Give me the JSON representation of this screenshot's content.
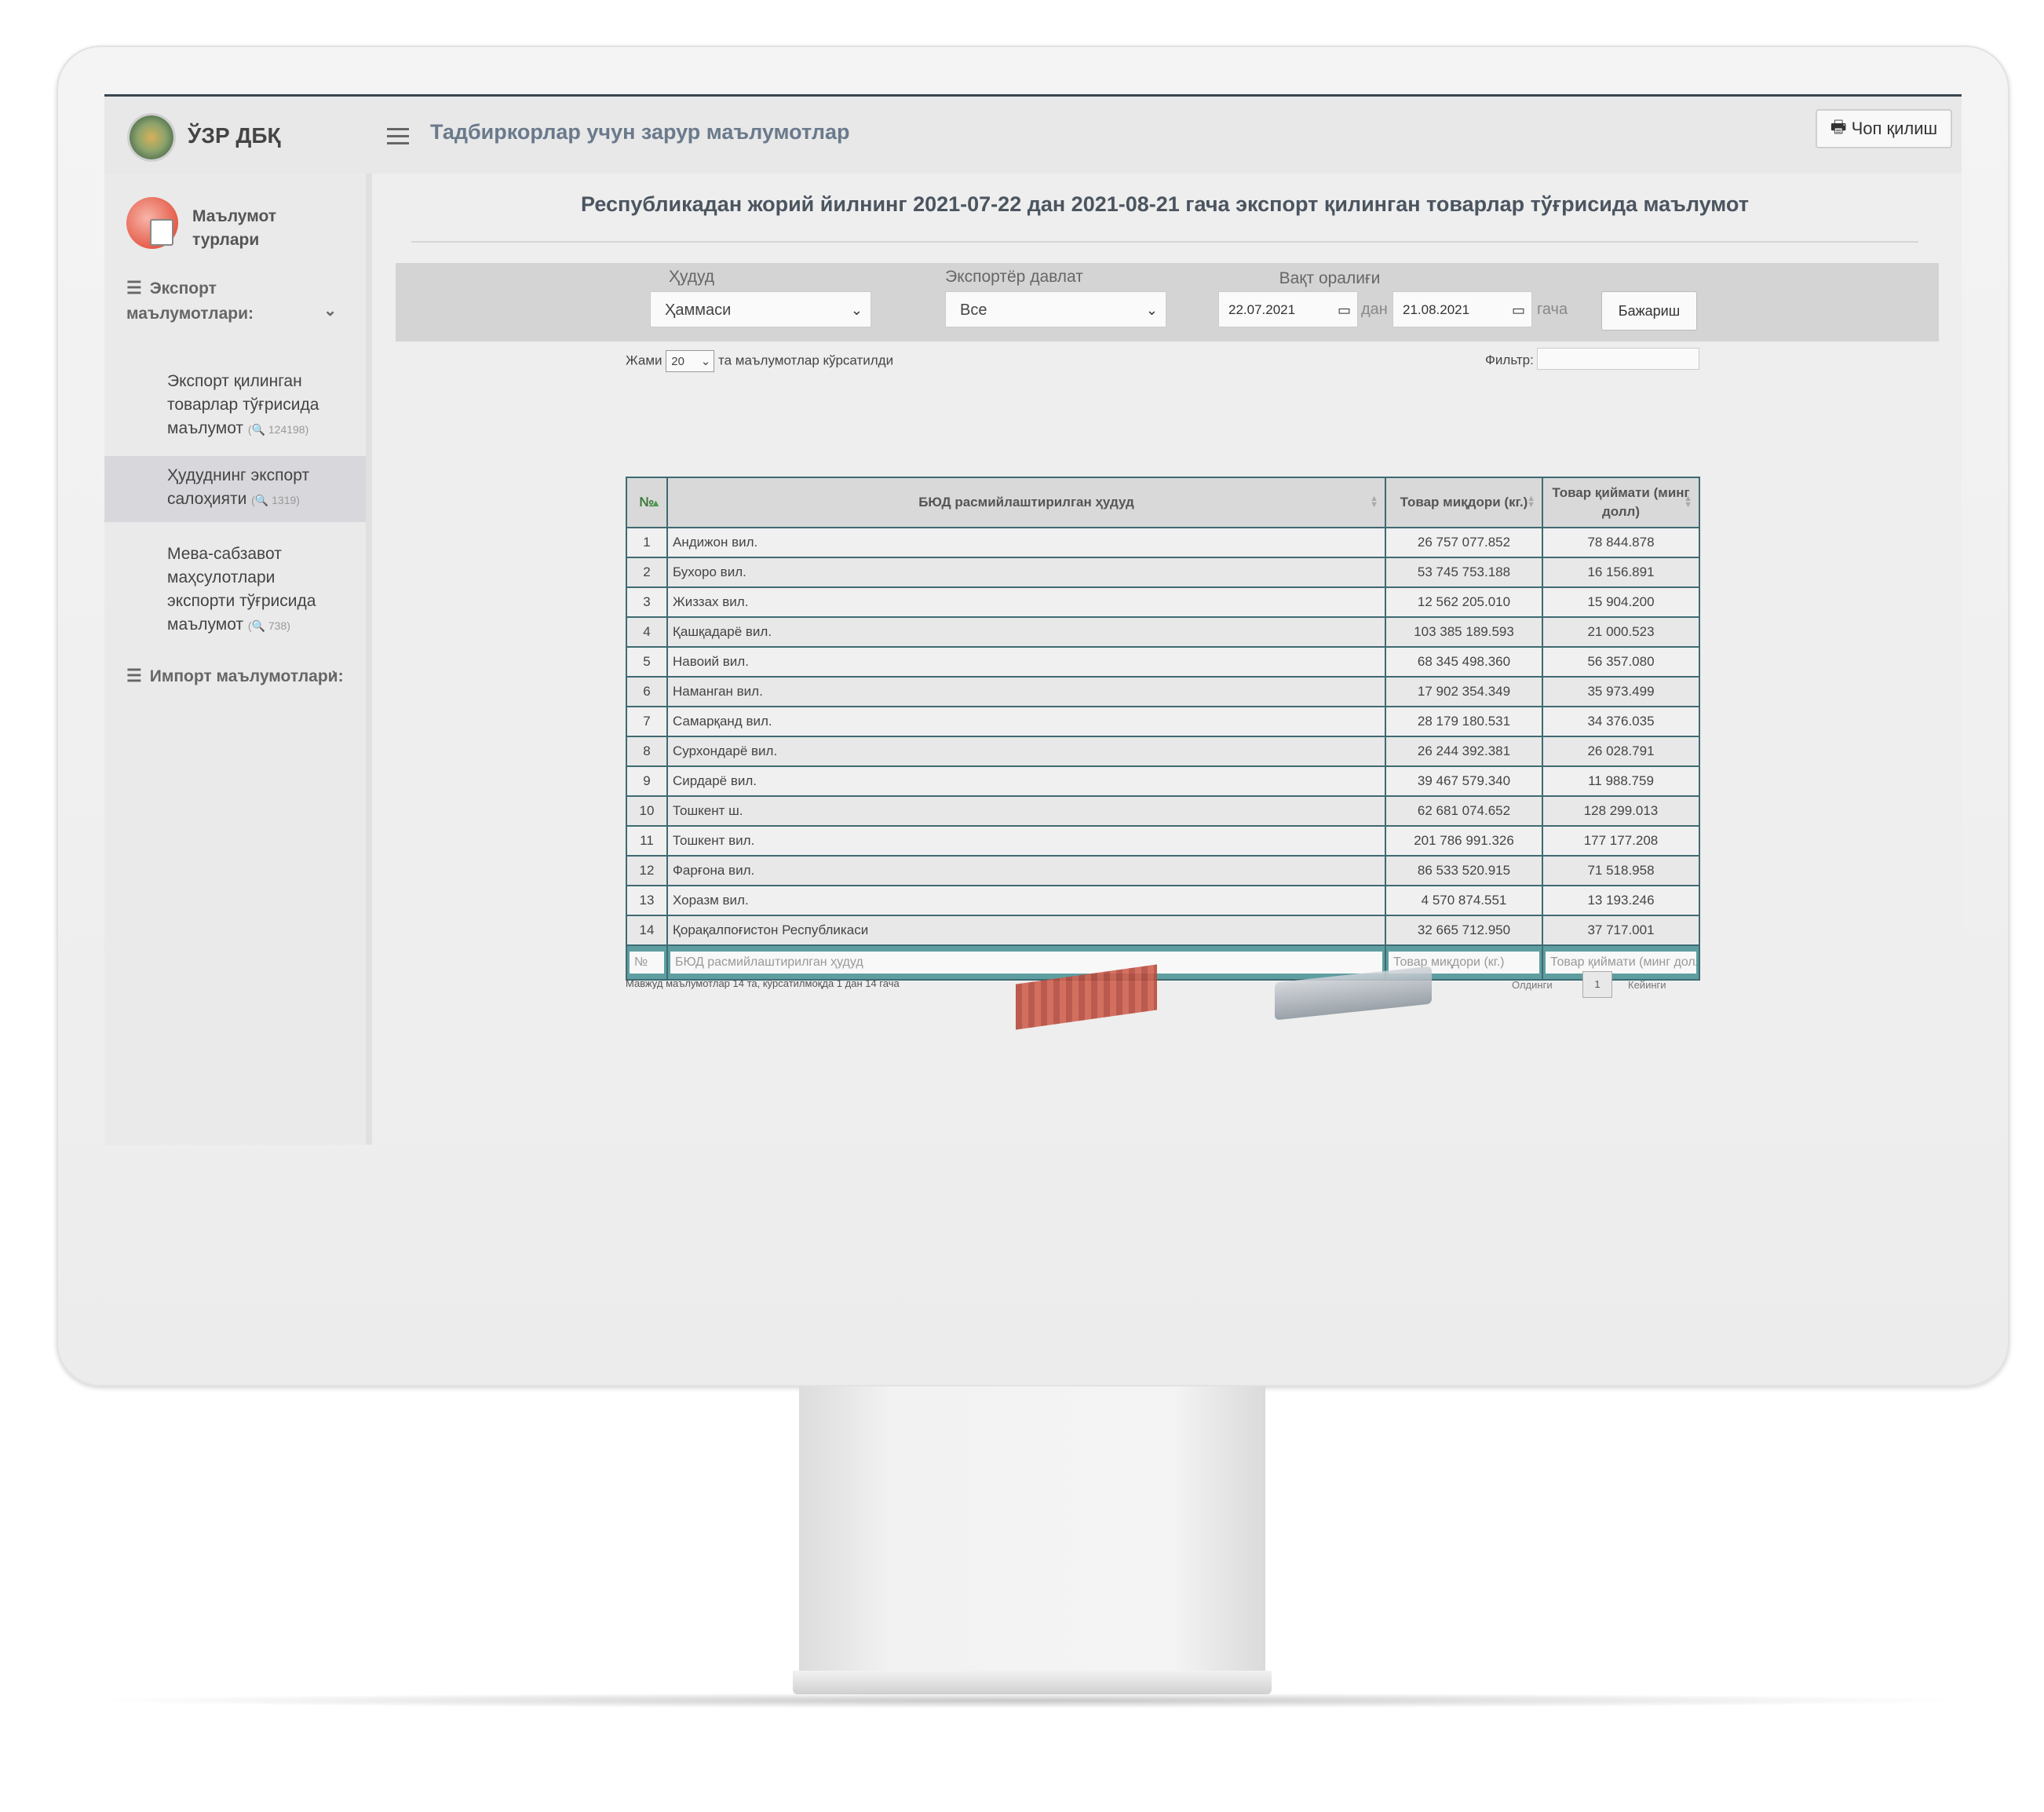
{
  "app": {
    "brand": "ЎЗР ДБҚ",
    "title": "Тадбиркорлар учун зарур маълумотлар",
    "print_label": "Чоп қилиш"
  },
  "sidebar": {
    "header": "Маълумот турлари",
    "export_group": "Экспорт маълумотлари:",
    "import_group": "Импорт маълумотлари:",
    "items": [
      {
        "label": "Экспорт қилинган товарлар тўғрисида маълумот",
        "count": "124198"
      },
      {
        "label": "Ҳудуднинг экспорт салоҳияти",
        "count": "1319"
      },
      {
        "label": "Мева-сабзавот маҳсулотлари экспорти тўғрисида маълумот",
        "count": "738"
      }
    ]
  },
  "page": {
    "heading": "Республикадан жорий йилнинг 2021-07-22 дан 2021-08-21 гача экспорт қилинган товарлар тўғрисида маълумот"
  },
  "filters": {
    "region_label": "Ҳудуд",
    "region_value": "Ҳаммаси",
    "country_label": "Экспортёр давлат",
    "country_value": "Все",
    "period_label": "Вақт оралиғи",
    "date_from": "22.07.2021",
    "from_word": "дан",
    "date_to": "21.08.2021",
    "to_word": "гача",
    "submit_label": "Бажариш"
  },
  "table_controls": {
    "show_prefix": "Жами",
    "page_length": "20",
    "show_suffix": "та маълумотлар кўрсатилди",
    "filter_label": "Фильтр:"
  },
  "table": {
    "columns": [
      "№",
      "БЮД расмийлаштирилган ҳудуд",
      "Товар миқдори (кг.)",
      "Товар қиймати (минг долл)"
    ],
    "rows": [
      [
        "1",
        "Андижон вил.",
        "26 757 077.852",
        "78 844.878"
      ],
      [
        "2",
        "Бухоро вил.",
        "53 745 753.188",
        "16 156.891"
      ],
      [
        "3",
        "Жиззах вил.",
        "12 562 205.010",
        "15 904.200"
      ],
      [
        "4",
        "Қашқадарё вил.",
        "103 385 189.593",
        "21 000.523"
      ],
      [
        "5",
        "Навоий вил.",
        "68 345 498.360",
        "56 357.080"
      ],
      [
        "6",
        "Наманган вил.",
        "17 902 354.349",
        "35 973.499"
      ],
      [
        "7",
        "Самарқанд вил.",
        "28 179 180.531",
        "34 376.035"
      ],
      [
        "8",
        "Сурхондарё вил.",
        "26 244 392.381",
        "26 028.791"
      ],
      [
        "9",
        "Сирдарё вил.",
        "39 467 579.340",
        "11 988.759"
      ],
      [
        "10",
        "Тошкент ш.",
        "62 681 074.652",
        "128 299.013"
      ],
      [
        "11",
        "Тошкент вил.",
        "201 786 991.326",
        "177 177.208"
      ],
      [
        "12",
        "Фарғона вил.",
        "86 533 520.915",
        "71 518.958"
      ],
      [
        "13",
        "Хоразм вил.",
        "4 570 874.551",
        "13 193.246"
      ],
      [
        "14",
        "Қорақалпоғистон Республикаси",
        "32 665 712.950",
        "37 717.001"
      ]
    ],
    "footer_placeholders": [
      "№",
      "БЮД расмийлаштирилган ҳудуд",
      "Товар миқдори (кг.)",
      "Товар қиймати (минг долл)"
    ]
  },
  "pagination": {
    "info": "Мавжуд маълумотлар 14 та, кўрсатилмоқда 1 дан 14 гача",
    "prev": "Олдинги",
    "page": "1",
    "next": "Кейинги"
  }
}
